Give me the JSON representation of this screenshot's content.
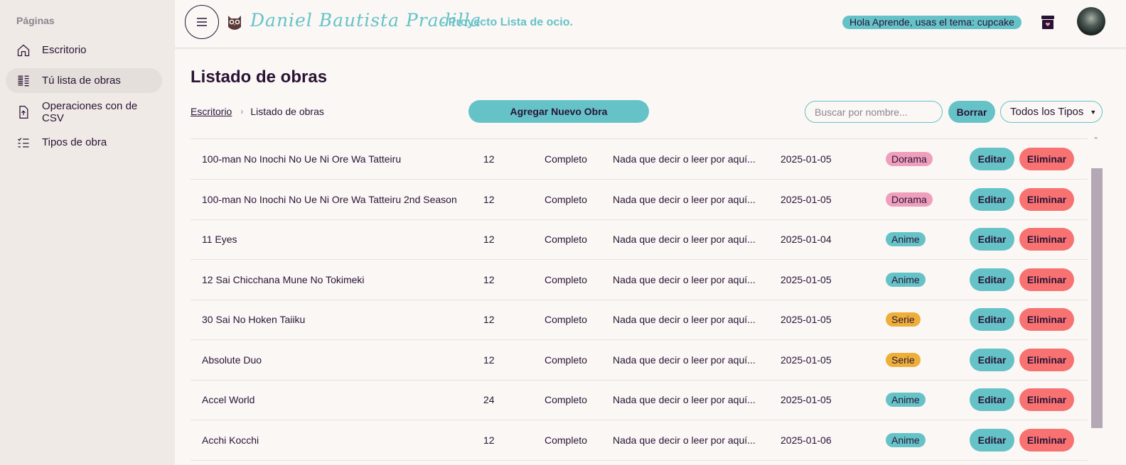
{
  "sidebar": {
    "title": "Páginas",
    "items": [
      {
        "label": "Escritorio",
        "icon": "home-icon"
      },
      {
        "label": "Tú lista de obras",
        "icon": "list-icon"
      },
      {
        "label": "Operaciones con de CSV",
        "icon": "file-upload-icon"
      },
      {
        "label": "Tipos de obra",
        "icon": "checklist-icon"
      }
    ]
  },
  "header": {
    "brand_name": "Daniel Bautista Pradilla",
    "brand_sub": "- Proyecto Lista de ocio.",
    "greeting": "Hola Aprende, usas el tema: cupcake"
  },
  "main": {
    "title": "Listado de obras",
    "breadcrumb": [
      "Escritorio",
      "Listado de obras"
    ],
    "add_label": "Agregar Nuevo Obra",
    "search_placeholder": "Buscar por nombre...",
    "clear_label": "Borrar",
    "type_filter": "Todos los Tipos"
  },
  "table": {
    "edit_label": "Editar",
    "delete_label": "Eliminar",
    "rows": [
      {
        "name": "100-man No Inochi No Ue Ni Ore Wa Tatteiru",
        "episodes": "12",
        "status": "Completo",
        "notes": "Nada que decir o leer por aquí...",
        "date": "2025-01-05",
        "type": "Dorama"
      },
      {
        "name": "100-man No Inochi No Ue Ni Ore Wa Tatteiru 2nd Season",
        "episodes": "12",
        "status": "Completo",
        "notes": "Nada que decir o leer por aquí...",
        "date": "2025-01-05",
        "type": "Dorama"
      },
      {
        "name": "11 Eyes",
        "episodes": "12",
        "status": "Completo",
        "notes": "Nada que decir o leer por aquí...",
        "date": "2025-01-04",
        "type": "Anime"
      },
      {
        "name": "12 Sai Chicchana Mune No Tokimeki",
        "episodes": "12",
        "status": "Completo",
        "notes": "Nada que decir o leer por aquí...",
        "date": "2025-01-05",
        "type": "Anime"
      },
      {
        "name": "30 Sai No Hoken Taiiku",
        "episodes": "12",
        "status": "Completo",
        "notes": "Nada que decir o leer por aquí...",
        "date": "2025-01-05",
        "type": "Serie"
      },
      {
        "name": "Absolute Duo",
        "episodes": "12",
        "status": "Completo",
        "notes": "Nada que decir o leer por aquí...",
        "date": "2025-01-05",
        "type": "Serie"
      },
      {
        "name": "Accel World",
        "episodes": "24",
        "status": "Completo",
        "notes": "Nada que decir o leer por aquí...",
        "date": "2025-01-05",
        "type": "Anime"
      },
      {
        "name": "Acchi Kocchi",
        "episodes": "12",
        "status": "Completo",
        "notes": "Nada que decir o leer por aquí...",
        "date": "2025-01-06",
        "type": "Anime"
      }
    ]
  },
  "colors": {
    "primary": "#65c3c8",
    "error": "#f87272",
    "dorama": "#ef9fbc",
    "serie": "#eeaf3a",
    "text": "#291334"
  }
}
